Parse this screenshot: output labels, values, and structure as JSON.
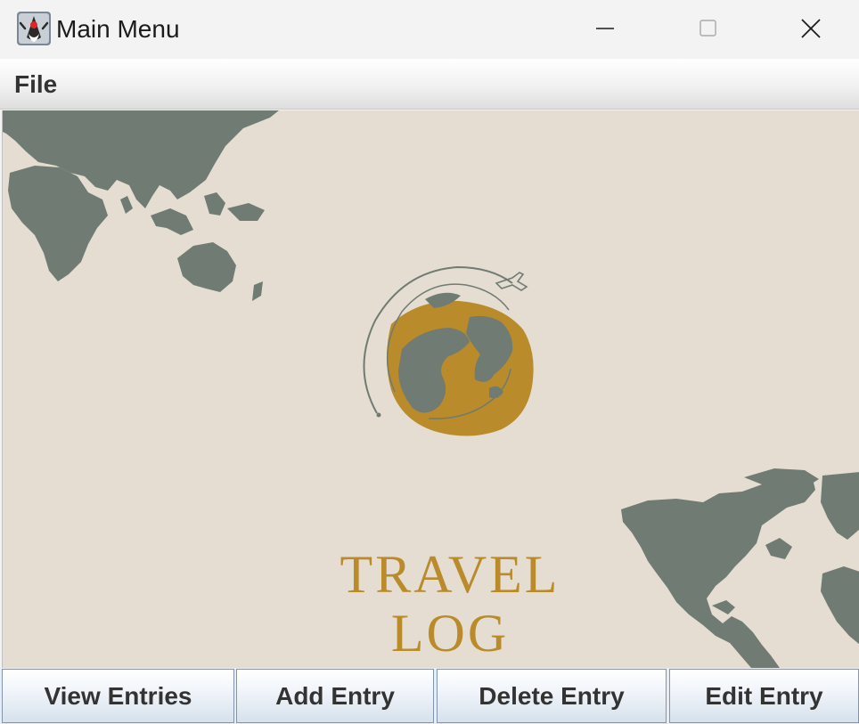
{
  "window": {
    "title": "Main Menu",
    "icon": "java-duke-icon",
    "controls": [
      "minimize-icon",
      "maximize-icon",
      "close-icon"
    ]
  },
  "menubar": {
    "file_label": "File"
  },
  "banner": {
    "logo_text": "TRAVEL LOG",
    "colors": {
      "background": "#e5ddd1",
      "continents": "#6f7b73",
      "globe": "#b98b2b"
    }
  },
  "buttons": {
    "view_entries": "View Entries",
    "add_entry": "Add Entry",
    "delete_entry": "Delete Entry",
    "edit_entry": "Edit Entry"
  }
}
